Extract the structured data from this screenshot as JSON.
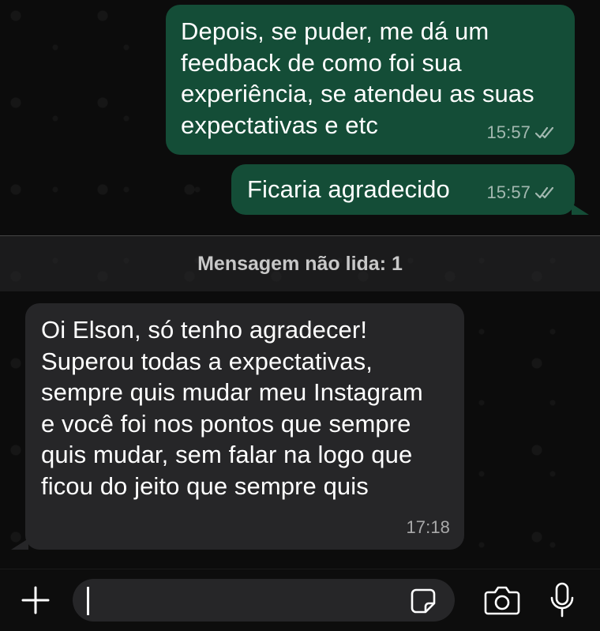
{
  "messages": [
    {
      "direction": "outgoing",
      "text": "Depois, se puder, me dá um\nfeedback de como foi sua\nexperiência, se atendeu as suas\nexpectativas e etc",
      "time": "15:57",
      "status": "double-check-read"
    },
    {
      "direction": "outgoing",
      "text": "Ficaria agradecido",
      "time": "15:57",
      "status": "double-check-read"
    },
    {
      "direction": "incoming",
      "text": "Oi Elson, só tenho agradecer!\nSuperou todas a expectativas,\nsempre quis mudar meu Instagram\ne você foi nos pontos que sempre\nquis mudar, sem falar na logo que\nficou do jeito que sempre quis",
      "time": "17:18"
    }
  ],
  "unread_divider": {
    "label": "Mensagem não lida: 1"
  },
  "composer": {
    "value": "",
    "icons": [
      "plus-icon",
      "sticker-icon",
      "camera-icon",
      "microphone-icon"
    ]
  },
  "colors": {
    "outgoing_bubble": "#144d37",
    "incoming_bubble": "#262628",
    "background": "#0b0b0b",
    "meta_text": "#9a9a9a"
  }
}
